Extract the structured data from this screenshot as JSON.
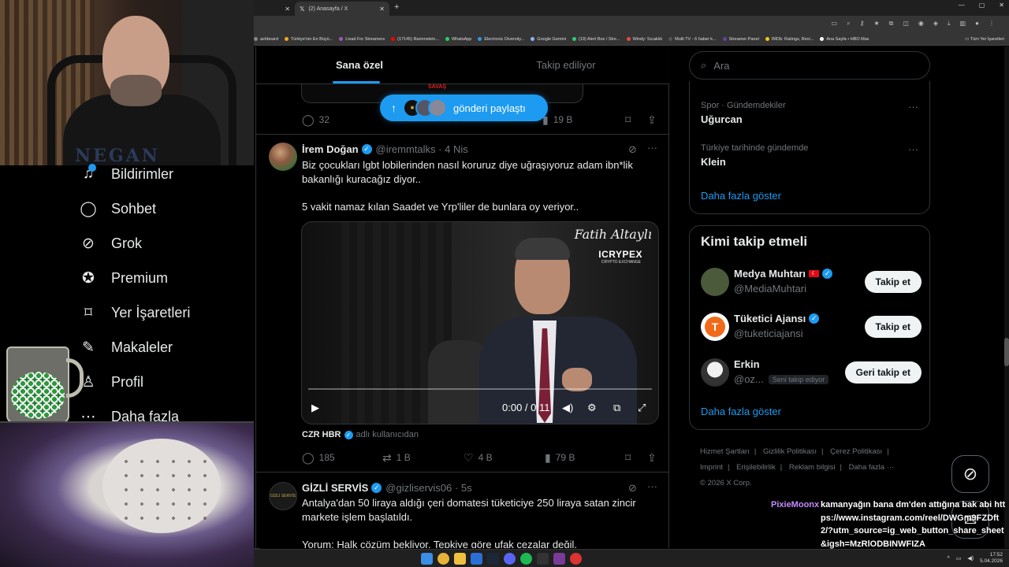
{
  "browser": {
    "tabs": [
      {
        "label": ""
      },
      {
        "label": "(2) Anasayfa / X"
      }
    ],
    "bookmarks": [
      {
        "label": "ashboard",
        "color": "#888888"
      },
      {
        "label": "Türkiye'nin En Büyü...",
        "color": "#f5a623"
      },
      {
        "label": "Livad For Streamers",
        "color": "#9b59b6"
      },
      {
        "label": "(17145) Rammstein...",
        "color": "#ff0000"
      },
      {
        "label": "WhatsApp",
        "color": "#25d366"
      },
      {
        "label": "Electronic Diversity...",
        "color": "#3498db"
      },
      {
        "label": "Google Gemini",
        "color": "#8ab4f8"
      },
      {
        "label": "(19) Alert Box / Stre...",
        "color": "#2ecc71"
      },
      {
        "label": "Windy: Sıcaklık",
        "color": "#e74c3c"
      },
      {
        "label": "Multi TV - 6 haber k...",
        "color": "#555555"
      },
      {
        "label": "Streamer Panel",
        "color": "#6441a5"
      },
      {
        "label": "IMDb: Ratings, Revi...",
        "color": "#f5c518"
      },
      {
        "label": "Ana Sayfa • HBO Max",
        "color": "#ffffff"
      }
    ],
    "all_bookmarks": "Tüm Yer İşaretleri"
  },
  "feed": {
    "tabs": [
      {
        "label": "Sana özel",
        "active": true
      },
      {
        "label": "Takip ediliyor",
        "active": false
      }
    ],
    "new_posts_label": "gönderi paylaştı",
    "prev_post": {
      "replies": "32",
      "views": "19 B",
      "media_text": "SAVAŞ"
    },
    "posts": [
      {
        "name": "İrem Doğan",
        "handle": "@iremmtalks",
        "time": "4 Nis",
        "text1": "Biz çocukları lgbt lobilerinden nasıl koruruz diye uğraşıyoruz adam ibn*lik bakanlığı kuracağız diyor..",
        "text2": "5 vakit namaz kılan Saadet ve Yrp'liler de bunlara oy veriyor..",
        "video": {
          "watermark1": "Fatih Altaylı",
          "watermark2": "ICRYPEX",
          "watermark3": "CRYPTO EXCHANGE",
          "time": "0:00 / 0:11",
          "progress": 0
        },
        "source_name": "CZR HBR",
        "source_suffix": "adlı kullanıcıdan",
        "replies": "185",
        "reposts": "1 B",
        "likes": "4 B",
        "views": "79 B"
      },
      {
        "name": "GİZLİ SERVİS",
        "handle": "@gizliservis06",
        "time": "5s",
        "avatar_text": "GİZLİ SERVİS",
        "text1": "Antalya'dan 50 liraya aldığı çeri domatesi tüketiciye 250 liraya satan zincir markete işlem başlatıldı.",
        "text2": "Yorum: Halk çözüm bekliyor. Tepkiye göre ufak cezalar değil."
      }
    ]
  },
  "sidebar": {
    "search_placeholder": "Ara",
    "trends": [
      {
        "meta": "Spor · Gündemdekiler",
        "term": "Uğurcan"
      },
      {
        "meta": "Türkiye tarihinde gündemde",
        "term": "Klein"
      }
    ],
    "trends_show_more": "Daha fazla göster",
    "who_to_follow": {
      "title": "Kimi takip etmeli",
      "items": [
        {
          "name": "Medya Muhtarı",
          "handle": "@MediaMuhtari",
          "button": "Takip et",
          "avatar_color": "#4a5a3a"
        },
        {
          "name": "Tüketici Ajansı",
          "handle": "@tuketiciajansi",
          "button": "Takip et",
          "avatar_color": "#f06a1a"
        },
        {
          "name": "Erkin",
          "handle": "@oz...",
          "follows_you": "Seni takip ediyor",
          "button": "Geri takip et",
          "avatar_color": "#d0d0d0"
        }
      ],
      "show_more": "Daha fazla göster"
    },
    "footer": [
      "Hizmet Şartları",
      "|",
      "Gizlilik Politikası",
      "|",
      "Çerez Politikası",
      "|",
      "Imprint",
      "|",
      "Erişilebilirlik",
      "|",
      "Reklam bilgisi",
      "|",
      "Daha fazla ···",
      "© 2026 X Corp."
    ]
  },
  "nav": {
    "items": [
      {
        "label": "Bildirimler",
        "icon": "bell-icon",
        "glyph": "🔔"
      },
      {
        "label": "Sohbet",
        "icon": "chat-icon",
        "glyph": "◯"
      },
      {
        "label": "Grok",
        "icon": "grok-icon",
        "glyph": "⊘"
      },
      {
        "label": "Premium",
        "icon": "premium-icon",
        "glyph": "✪"
      },
      {
        "label": "Yer İşaretleri",
        "icon": "bookmark-icon",
        "glyph": "⌑"
      },
      {
        "label": "Makaleler",
        "icon": "article-icon",
        "glyph": "✎"
      },
      {
        "label": "Profil",
        "icon": "profile-icon",
        "glyph": "♙"
      },
      {
        "label": "Daha fazla",
        "icon": "more-icon",
        "glyph": "⋯"
      }
    ]
  },
  "stream": {
    "webcam_logo": "NEGAN",
    "chat": {
      "user": "PixieMoonx",
      "message": "kamanyağın bana dm'den attığına bak abi https://www.instagram.com/reel/DWGm9FZDft2/?utm_source=ig_web_button_share_sheet&igsh=MzRlODBINWFIZA"
    }
  },
  "taskbar": {
    "time": "17:52",
    "date": "5.04.2026"
  },
  "colors": {
    "accent": "#1d9bf0",
    "background": "#000000",
    "text_primary": "#e7e9ea",
    "text_secondary": "#71767b",
    "border": "#2f3336"
  }
}
